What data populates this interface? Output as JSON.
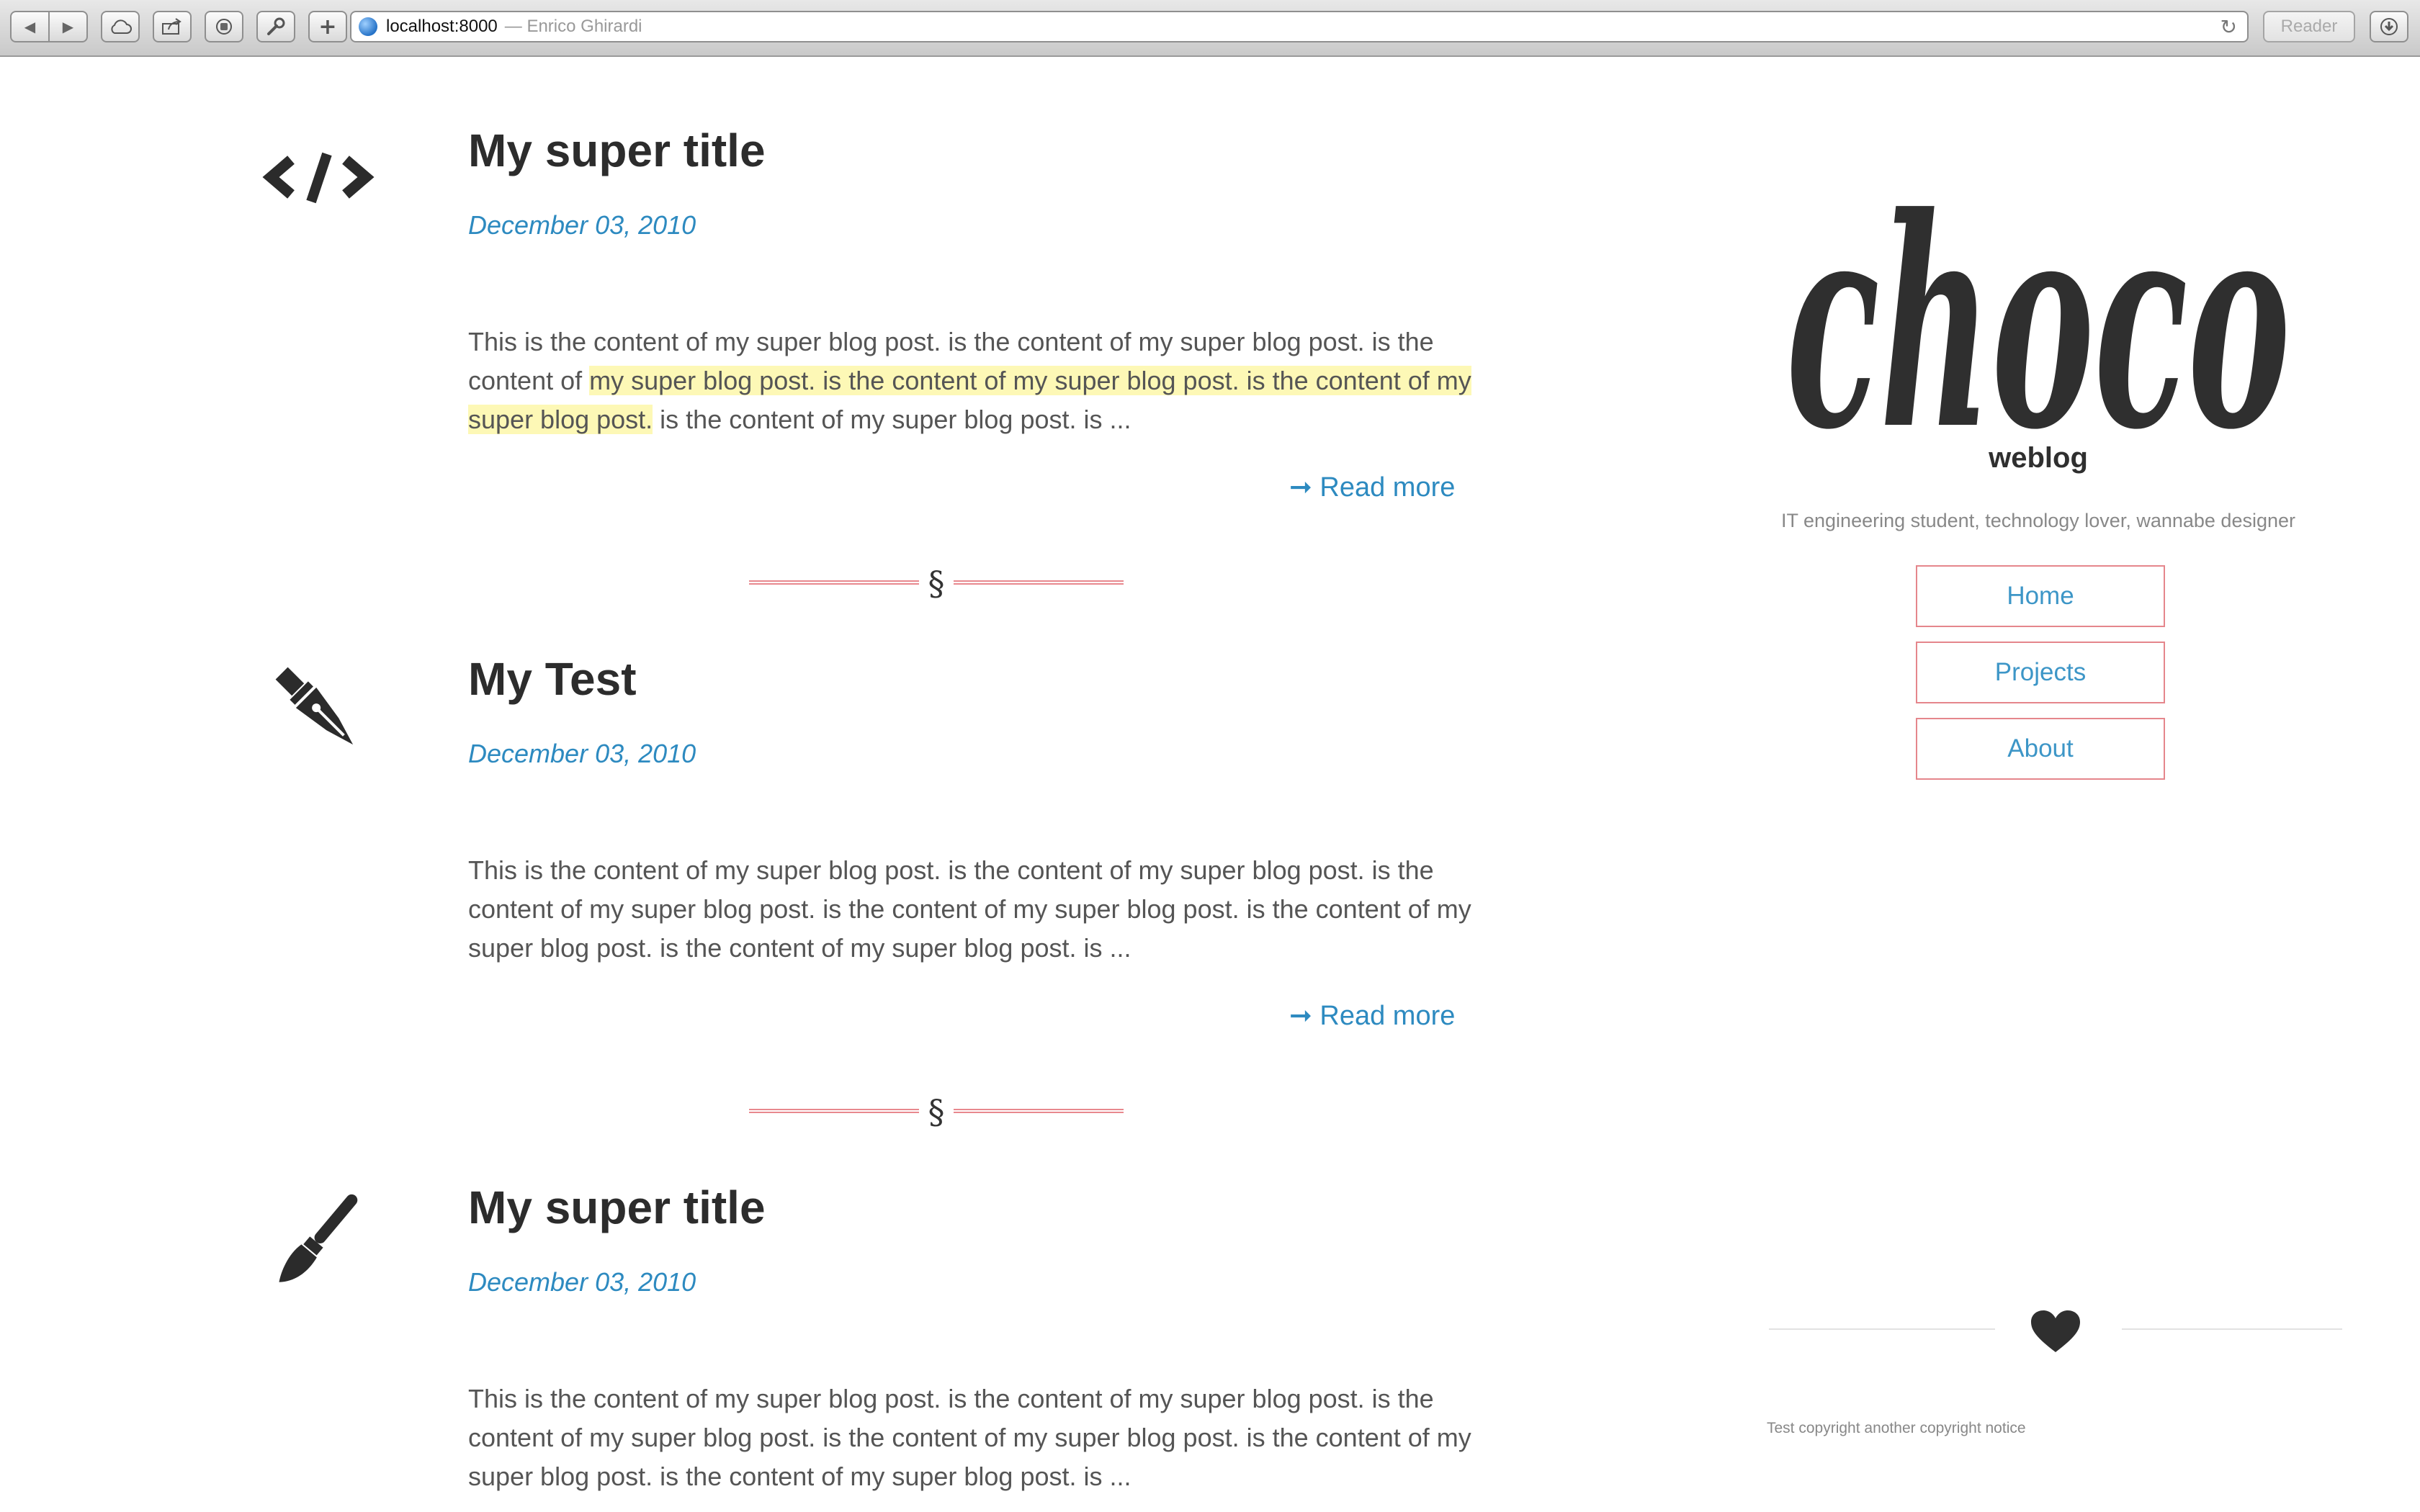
{
  "browser": {
    "back_icon": "triangle-left",
    "forward_icon": "triangle-right",
    "url_host": "localhost:8000",
    "url_page_title": "— Enrico Ghirardi",
    "reader_label": "Reader"
  },
  "posts": [
    {
      "icon": "code-icon",
      "title": "My super title",
      "date": "December 03, 2010",
      "excerpt_before": "This is the content of my super blog post. is the content of my super blog post. is the content of ",
      "excerpt_highlight": "my super blog post. is the content of my super blog post. is the content of my super blog post.",
      "excerpt_after": " is the content of my super blog post. is ...",
      "read_more": "➞ Read more"
    },
    {
      "icon": "fountain-pen-icon",
      "title": "My Test",
      "date": "December 03, 2010",
      "excerpt": "This is the content of my super blog post. is the content of my super blog post. is the content of my super blog post. is the content of my super blog post. is the content of my super blog post. is the content of my super blog post. is ...",
      "read_more": "➞ Read more"
    },
    {
      "icon": "paintbrush-icon",
      "title": "My super title",
      "date": "December 03, 2010",
      "excerpt": "This is the content of my super blog post. is the content of my super blog post. is the content of my super blog post. is the content of my super blog post. is the content of my super blog post. is the content of my super blog post. is ..."
    }
  ],
  "divider_symbol": "§",
  "sidebar": {
    "logo_text": "choco",
    "logo_subtitle": "weblog",
    "tagline": "IT engineering student, technology lover, wannabe designer",
    "nav": [
      {
        "label": "Home"
      },
      {
        "label": "Projects"
      },
      {
        "label": "About"
      }
    ],
    "footer_icon": "heart-icon",
    "copyright": "Test copyright another copyright notice"
  },
  "colors": {
    "accent_link": "#2d8ac0",
    "nav_border": "#e5868c",
    "highlight": "#fdf8b6",
    "heading": "#2c2c2c"
  }
}
